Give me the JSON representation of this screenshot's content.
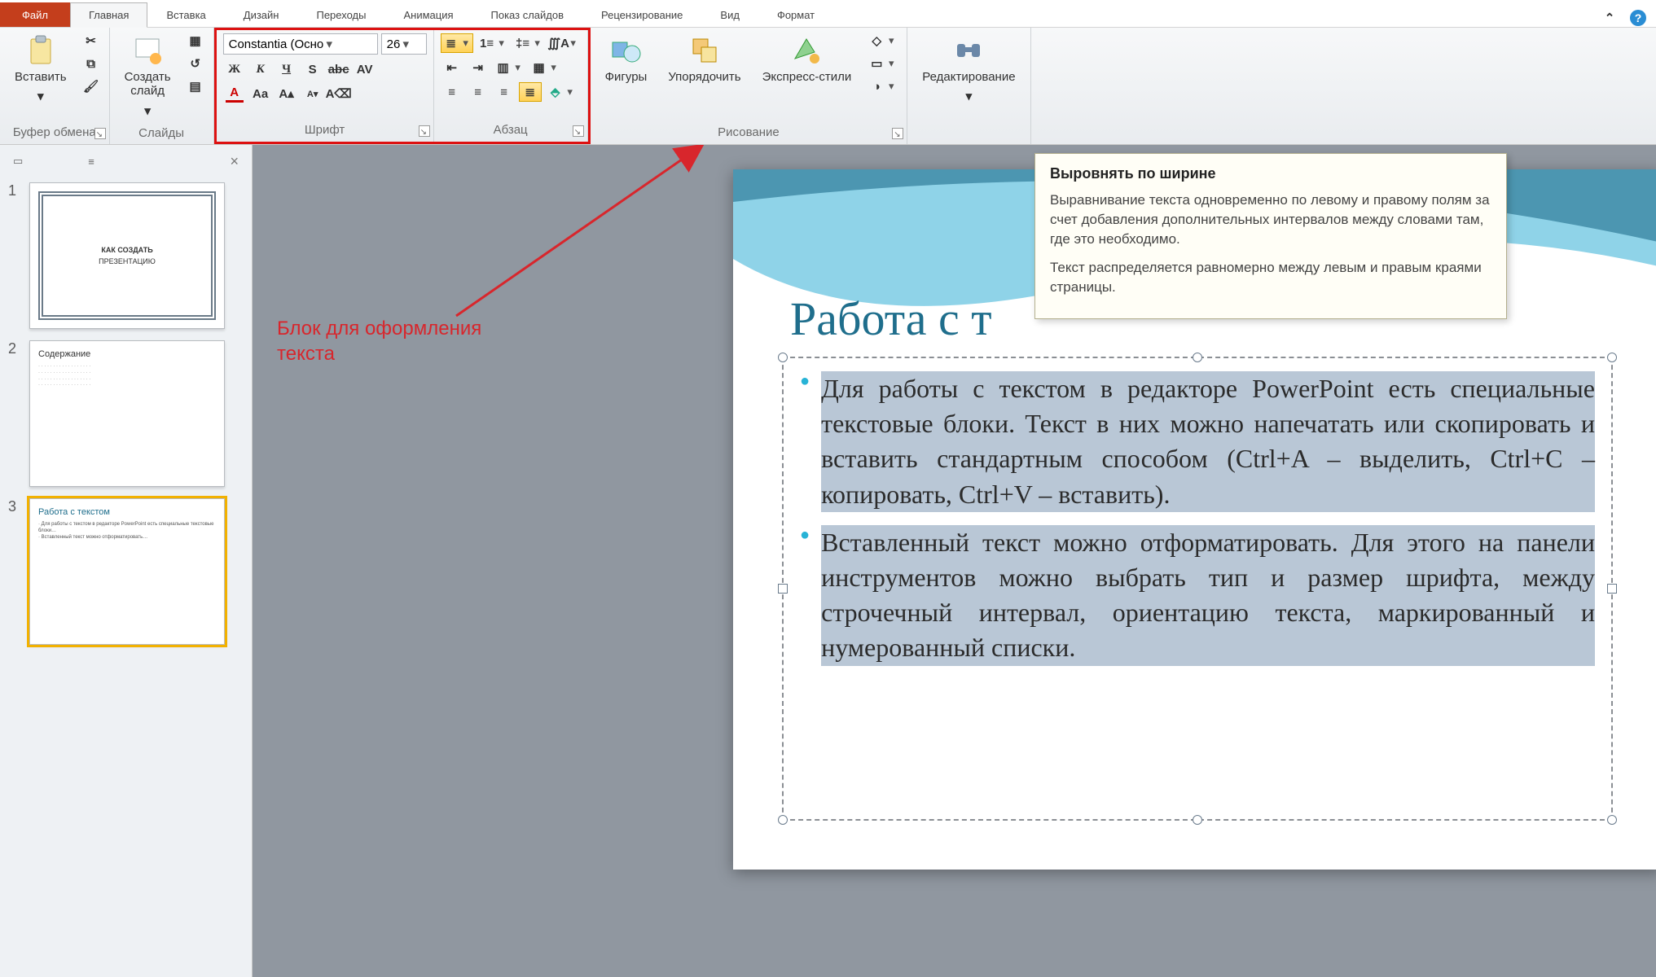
{
  "tabs": {
    "file": "Файл",
    "home": "Главная",
    "insert": "Вставка",
    "design": "Дизайн",
    "transitions": "Переходы",
    "animation": "Анимация",
    "slideshow": "Показ слайдов",
    "review": "Рецензирование",
    "view": "Вид",
    "format": "Формат"
  },
  "ribbon": {
    "clipboard": {
      "paste": "Вставить",
      "label": "Буфер обмена"
    },
    "slides": {
      "new": "Создать\nслайд",
      "label": "Слайды"
    },
    "font": {
      "name": "Constantia (Осно",
      "size": "26",
      "label": "Шрифт"
    },
    "paragraph": {
      "label": "Абзац"
    },
    "drawing": {
      "shapes": "Фигуры",
      "arrange": "Упорядочить",
      "quick": "Экспресс-стили",
      "label": "Рисование"
    },
    "editing": {
      "label": "Редактирование"
    }
  },
  "annotation": {
    "line1": "Блок для оформления",
    "line2": "текста"
  },
  "tooltip": {
    "title": "Выровнять по ширине",
    "p1": "Выравнивание текста одновременно по левому и правому полям за счет добавления дополнительных интервалов между словами там, где это необходимо.",
    "p2": "Текст распределяется равномерно между левым и правым краями страницы."
  },
  "slide": {
    "title": "Работа с т",
    "bullet1": "Для работы с текстом в редакторе PowerPoint есть специальные текстовые блоки. Текст в них можно напечатать или скопировать и вставить стандартным способом (Ctrl+A – выделить, Ctrl+C – копировать, Ctrl+V – вставить).",
    "bullet2": "Вставленный текст можно отформатировать. Для этого на панели инструментов можно выбрать тип и размер шрифта, между строчечный интервал, ориентацию текста, маркированный и нумерованный списки."
  },
  "thumbs": {
    "t1": {
      "num": "1",
      "title": "КАК СОЗДАТЬ",
      "sub": "ПРЕЗЕНТАЦИЮ"
    },
    "t2": {
      "num": "2",
      "title": "Содержание"
    },
    "t3": {
      "num": "3",
      "title": "Работа с текстом"
    }
  }
}
